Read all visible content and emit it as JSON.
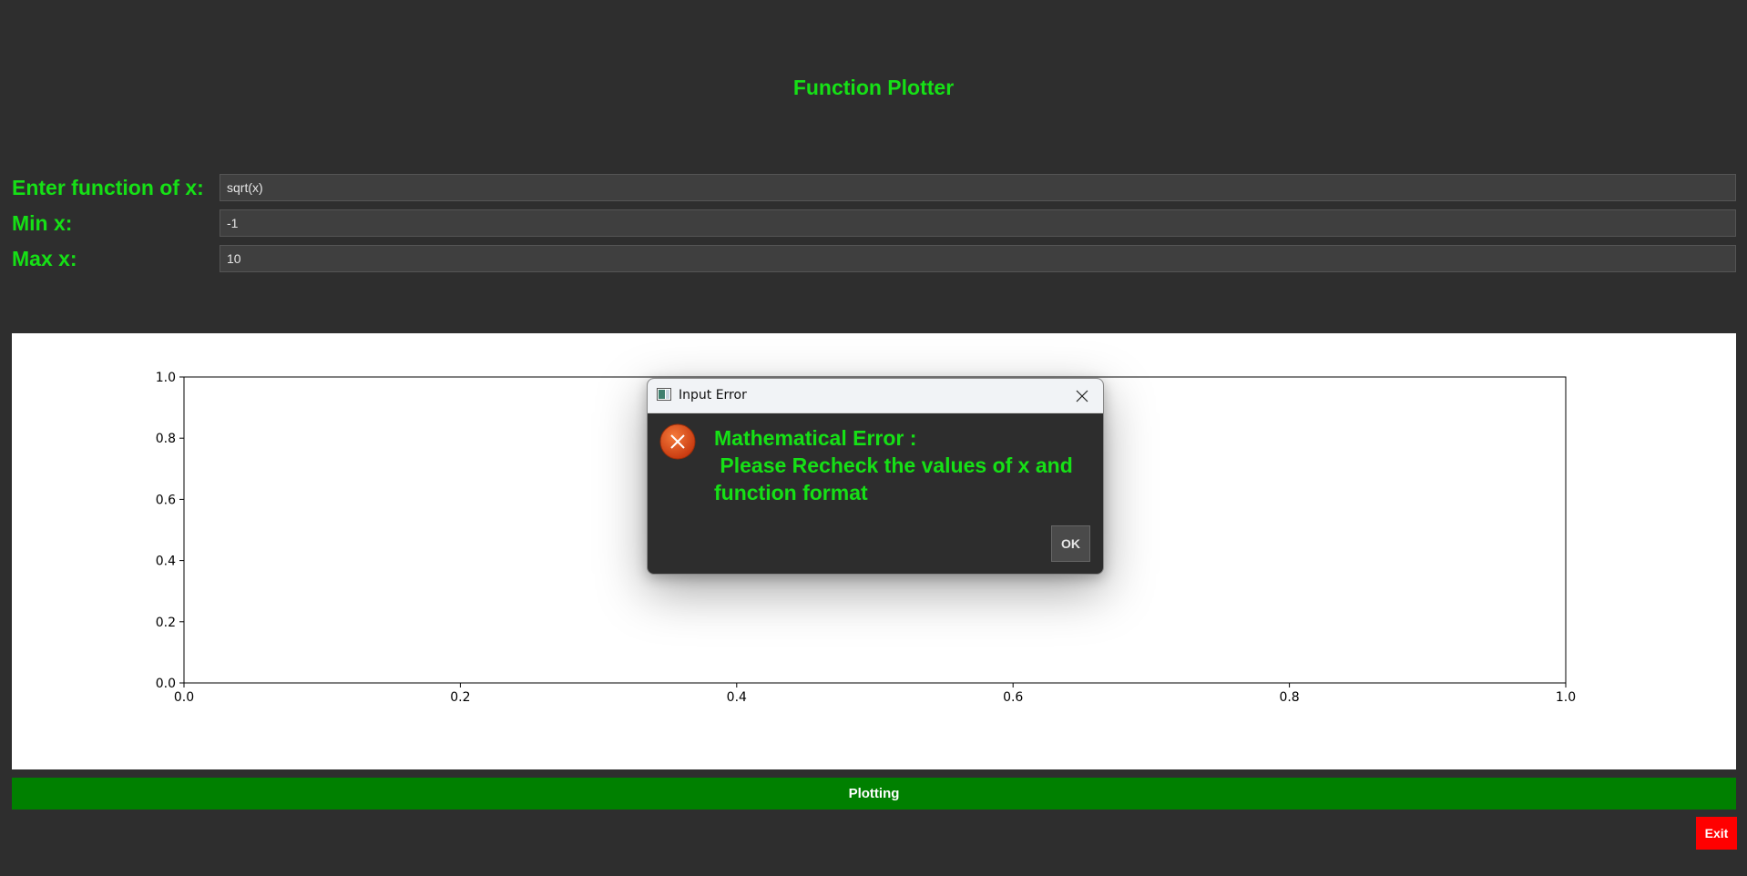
{
  "app": {
    "title": "Function Plotter"
  },
  "form": {
    "function_label": "Enter function of x:",
    "function_value": "sqrt(x)",
    "min_label": "Min x:",
    "min_value": "-1",
    "max_label": "Max x:",
    "max_value": "10"
  },
  "chart_data": {
    "type": "line",
    "title": "",
    "xlabel": "",
    "ylabel": "",
    "xlim": [
      0.0,
      1.0
    ],
    "ylim": [
      0.0,
      1.0
    ],
    "x_ticks": [
      "0.0",
      "0.2",
      "0.4",
      "0.6",
      "0.8",
      "1.0"
    ],
    "y_ticks": [
      "0.0",
      "0.2",
      "0.4",
      "0.6",
      "0.8",
      "1.0"
    ],
    "series": [],
    "grid": false
  },
  "buttons": {
    "plot_label": "Plotting",
    "exit_label": "Exit"
  },
  "dialog": {
    "title": "Input Error",
    "message": "Mathematical Error :\n Please Recheck the values of x and function format",
    "ok_label": "OK",
    "icon": "error-icon",
    "icon_color": "#e1501e"
  },
  "colors": {
    "background": "#2e2e2e",
    "accent_text": "#16e016",
    "plot_button": "#008000",
    "exit_button": "#ff0000"
  }
}
